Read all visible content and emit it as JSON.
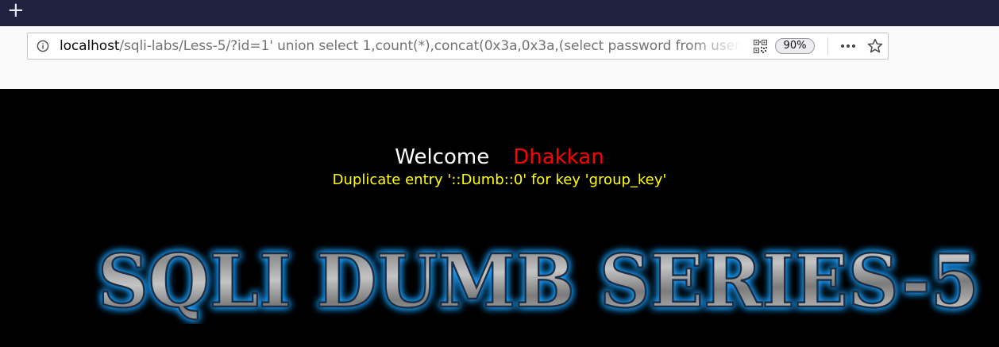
{
  "browser": {
    "new_tab_glyph": "+",
    "url_host": "localhost",
    "url_path": "/sqli-labs/Less-5/?id=1' union select 1,count(*),concat(0x3a,0x3a,(select password from users",
    "zoom": "90%",
    "icons": [
      "info-icon",
      "qr-code-icon",
      "more-icon",
      "bookmark-star-icon",
      "plus-icon"
    ]
  },
  "page": {
    "welcome_text": "Welcome",
    "username": "Dhakkan",
    "error_message": "Duplicate entry '::Dumb::0' for key 'group_key'",
    "banner_title": "SQLI DUMB SERIES-5"
  },
  "colors": {
    "tabstrip": "#202340",
    "toolbar": "#f9f9fa",
    "page_background": "#000000",
    "welcome": "#ffffff",
    "username": "#ff0000",
    "error": "#ffff00",
    "banner_glow": "#1ea0ff",
    "banner_fill": "#a9a9a9"
  }
}
